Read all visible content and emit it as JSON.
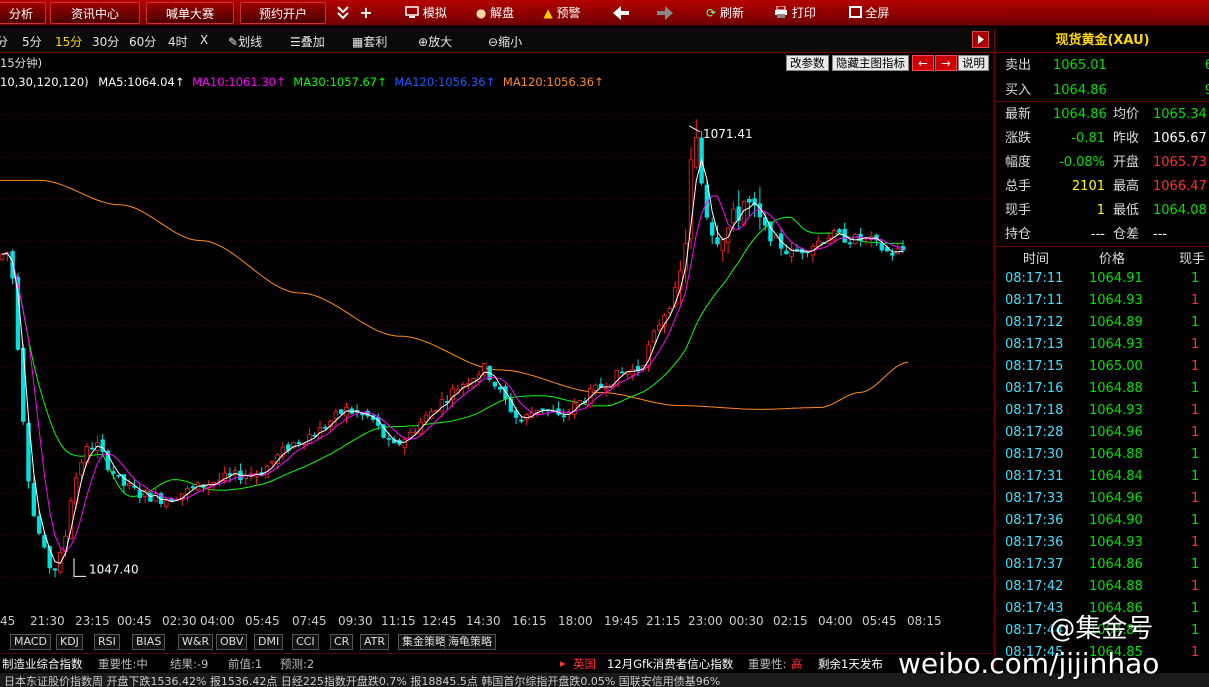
{
  "topbar": {
    "tab_analysis": "分析",
    "tab_news": "资讯中心",
    "tab_contest": "喊单大赛",
    "tab_account": "预约开户",
    "more_icon": "double-chevron-down",
    "plus_label": "+",
    "simulate": "模拟",
    "review": "解盘",
    "alert": "预警",
    "back_icon": "arrow-left",
    "forward_icon": "arrow-right",
    "refresh": "刷新",
    "print": "打印",
    "fullscreen": "全屏"
  },
  "periods": [
    "分",
    "5分",
    "15分",
    "30分",
    "60分",
    "4时",
    "X"
  ],
  "active_period": "15分",
  "tools": {
    "draw": "划线",
    "overlay": "叠加",
    "rights": "套利",
    "zoom_in": "放大",
    "zoom_out": "缩小"
  },
  "chart_header": {
    "period_label": "15分钟)",
    "ma_params": "10,30,120,120)",
    "ma5": "MA5:1064.04↑",
    "ma10": "MA10:1061.30↑",
    "ma30": "MA30:1057.67↑",
    "ma120a": "MA120:1056.36↑",
    "ma120b": "MA120:1056.36↑",
    "btn_params": "改参数",
    "btn_hide": "隐藏主图指标",
    "btn_help": "说明"
  },
  "annotations": {
    "high": "1071.41",
    "low": "1047.40"
  },
  "colors": {
    "ma5": "#ffffff",
    "ma10": "#ff00ff",
    "ma30": "#00ff00",
    "ma120a": "#1e5bff",
    "ma120b": "#ff8c1a",
    "up": "#ff2020",
    "down": "#00e0e0"
  },
  "chart_data": {
    "type": "candlestick",
    "ylim": [
      1045.5,
      1073
    ],
    "high": 1071.41,
    "low": 1047.4,
    "x_labels": [
      "45",
      "21:30",
      "23:15",
      "00:45",
      "02:30",
      "04:00",
      "05:45",
      "07:45",
      "09:30",
      "11:15",
      "12:45",
      "14:30",
      "16:15",
      "18:00",
      "19:45",
      "21:15",
      "23:00",
      "00:30",
      "02:15",
      "04:00",
      "05:45",
      "08:15"
    ]
  },
  "indicator_tabs": [
    "MACD",
    "KDJ",
    "RSI",
    "BIAS",
    "W&R",
    "OBV",
    "DMI",
    "CCI",
    "CR",
    "ATR",
    "集金策略",
    "海龟策略"
  ],
  "news1": {
    "left": "制造业综合指数",
    "imp_l": "重要性:中",
    "result": "结果:-9",
    "prev": "前值:1",
    "forecast": "预测:2",
    "country": "英国",
    "event": "12月Gfk消费者信心指数",
    "imp_r": "重要性:",
    "imp_r_val": "高",
    "remain": "剩余1天发布"
  },
  "news2": "日本东证股价指数周   开盘下跌1536.42%   报1536.42点      日经225指数开盘跌0.7%   报18845.5点      韩国首尔综指开盘跌0.05%      国联安信用债基96%",
  "quote": {
    "title": "现货黄金(XAU)",
    "rows": [
      {
        "l1": "卖出",
        "v1": "1065.01",
        "l2": "",
        "v2": "6"
      },
      {
        "l1": "买入",
        "v1": "1064.86",
        "l2": "",
        "v2": "9"
      },
      {
        "l1": "最新",
        "v1": "1064.86",
        "l2": "均价",
        "v2": "1065.34"
      },
      {
        "l1": "涨跌",
        "v1": "-0.81",
        "l2": "昨收",
        "v2": "1065.67"
      },
      {
        "l1": "幅度",
        "v1": "-0.08%",
        "l2": "开盘",
        "v2": "1065.73"
      },
      {
        "l1": "总手",
        "v1": "2101",
        "l2": "最高",
        "v2": "1066.47"
      },
      {
        "l1": "现手",
        "v1": "1",
        "l2": "最低",
        "v2": "1064.08"
      },
      {
        "l1": "持仓",
        "v1": "---",
        "l2": "仓差",
        "v2": "---"
      }
    ],
    "tick_headers": [
      "时间",
      "价格",
      "现手"
    ],
    "ticks": [
      [
        "08:17:11",
        "1064.91",
        "1",
        "g"
      ],
      [
        "08:17:11",
        "1064.93",
        "1",
        "r"
      ],
      [
        "08:17:12",
        "1064.89",
        "1",
        "g"
      ],
      [
        "08:17:13",
        "1064.93",
        "1",
        "r"
      ],
      [
        "08:17:15",
        "1065.00",
        "1",
        "r"
      ],
      [
        "08:17:16",
        "1064.88",
        "1",
        "g"
      ],
      [
        "08:17:18",
        "1064.93",
        "1",
        "r"
      ],
      [
        "08:17:28",
        "1064.96",
        "1",
        "r"
      ],
      [
        "08:17:30",
        "1064.88",
        "1",
        "g"
      ],
      [
        "08:17:31",
        "1064.84",
        "1",
        "g"
      ],
      [
        "08:17:33",
        "1064.96",
        "1",
        "r"
      ],
      [
        "08:17:36",
        "1064.90",
        "1",
        "g"
      ],
      [
        "08:17:36",
        "1064.93",
        "1",
        "r"
      ],
      [
        "08:17:37",
        "1064.86",
        "1",
        "g"
      ],
      [
        "08:17:42",
        "1064.88",
        "1",
        "r"
      ],
      [
        "08:17:43",
        "1064.86",
        "1",
        "g"
      ],
      [
        "08:17:44",
        "1064.84",
        "1",
        "g"
      ],
      [
        "08:17:45",
        "1064.85",
        "1",
        "r"
      ]
    ]
  },
  "watermark": "weibo.com/jijinhao",
  "watermark2": "@集金号"
}
